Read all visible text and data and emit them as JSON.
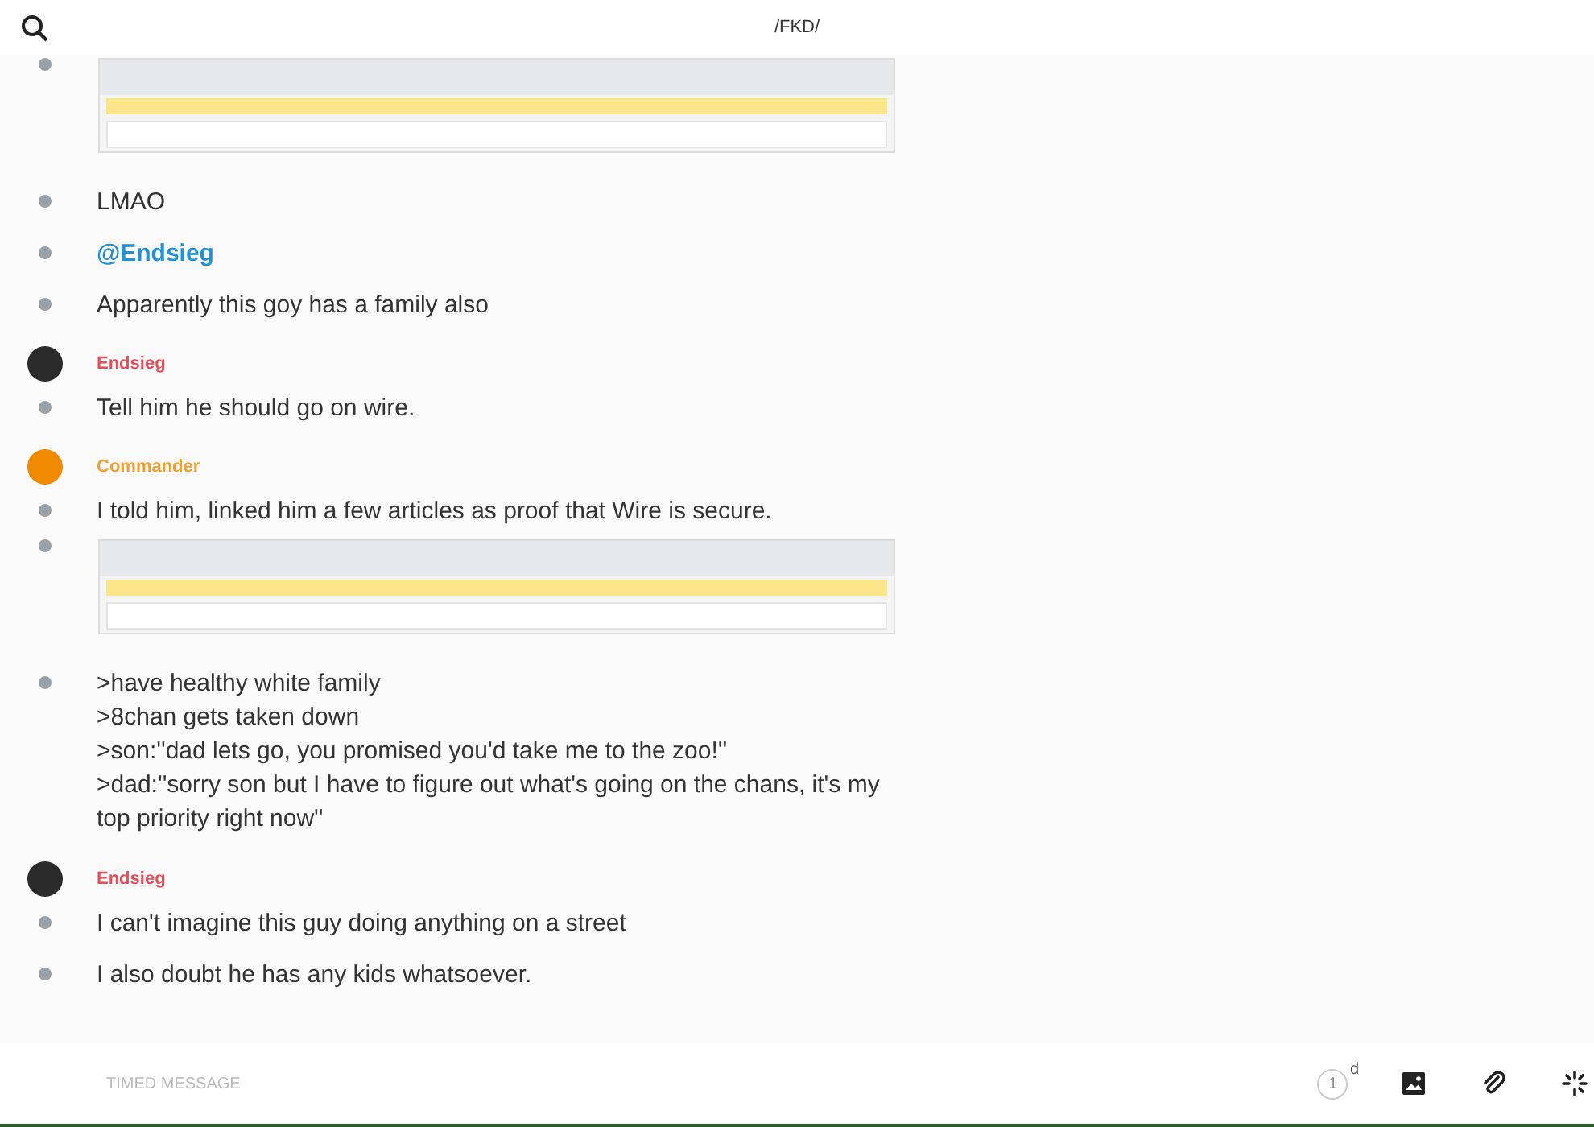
{
  "header": {
    "title": "/FKD/"
  },
  "conversation": [
    {
      "items": [
        {
          "kind": "image"
        },
        {
          "kind": "text",
          "text": "LMAO"
        },
        {
          "kind": "mention",
          "text": "@Endsieg"
        },
        {
          "kind": "text",
          "text": "Apparently this goy has a family also"
        }
      ]
    },
    {
      "sender": {
        "name": "Endsieg",
        "color": "#e4505a"
      },
      "items": [
        {
          "kind": "text",
          "text": "Tell him he should go on wire."
        }
      ]
    },
    {
      "sender": {
        "name": "Commander",
        "color": "#f0a030"
      },
      "items": [
        {
          "kind": "text",
          "text": "I told him, linked him a few articles as proof that Wire is secure."
        },
        {
          "kind": "image"
        },
        {
          "kind": "text",
          "text": ">have healthy white family\n>8chan gets taken down\n>son:''dad lets go, you promised you'd take me to the zoo!''\n>dad:''sorry son but I have to figure out what's going on the chans, it's my top priority right now''"
        }
      ]
    },
    {
      "sender": {
        "name": "Endsieg",
        "color": "#e4505a"
      },
      "items": [
        {
          "kind": "text",
          "text": "I can't imagine this guy doing anything on a street"
        },
        {
          "kind": "text",
          "text": "I also doubt he has any kids whatsoever."
        }
      ]
    }
  ],
  "composer": {
    "placeholder": "TIMED MESSAGE",
    "timer": {
      "value": "1",
      "unit": "d"
    }
  }
}
